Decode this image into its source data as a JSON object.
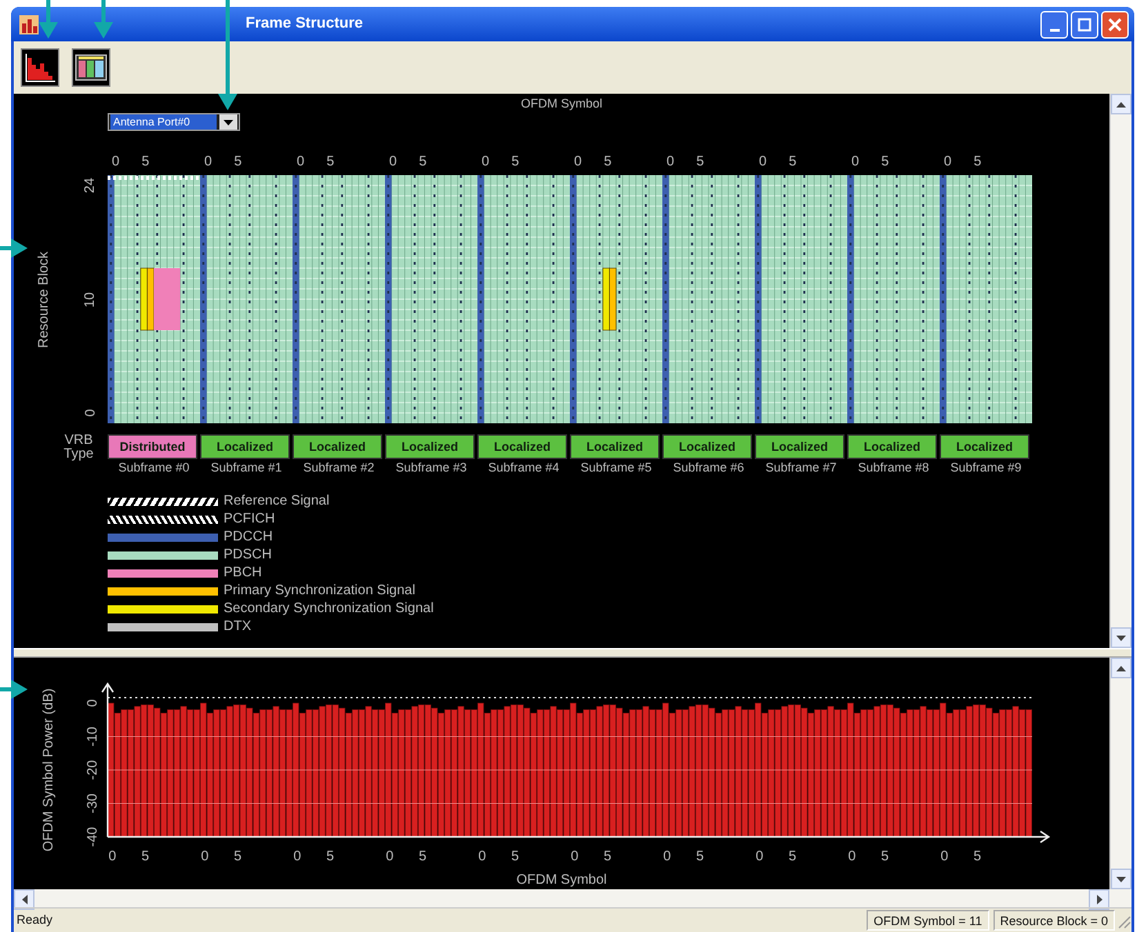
{
  "window": {
    "title": "Frame Structure"
  },
  "frame_view": {
    "title": "OFDM Symbol",
    "antenna_select": {
      "value": "Antenna Port#0"
    },
    "y_axis": {
      "label": "Resource Block",
      "ticks": [
        "24",
        "10",
        "0"
      ]
    },
    "vrb_row_label": "VRB Type",
    "subframes": [
      {
        "ticks": [
          "0",
          "5"
        ],
        "vrb_type": "Distributed",
        "color": "#e878b8",
        "label": "Subframe #0"
      },
      {
        "ticks": [
          "0",
          "5"
        ],
        "vrb_type": "Localized",
        "color": "#5cc040",
        "label": "Subframe #1"
      },
      {
        "ticks": [
          "0",
          "5"
        ],
        "vrb_type": "Localized",
        "color": "#5cc040",
        "label": "Subframe #2"
      },
      {
        "ticks": [
          "0",
          "5"
        ],
        "vrb_type": "Localized",
        "color": "#5cc040",
        "label": "Subframe #3"
      },
      {
        "ticks": [
          "0",
          "5"
        ],
        "vrb_type": "Localized",
        "color": "#5cc040",
        "label": "Subframe #4"
      },
      {
        "ticks": [
          "0",
          "5"
        ],
        "vrb_type": "Localized",
        "color": "#5cc040",
        "label": "Subframe #5"
      },
      {
        "ticks": [
          "0",
          "5"
        ],
        "vrb_type": "Localized",
        "color": "#5cc040",
        "label": "Subframe #6"
      },
      {
        "ticks": [
          "0",
          "5"
        ],
        "vrb_type": "Localized",
        "color": "#5cc040",
        "label": "Subframe #7"
      },
      {
        "ticks": [
          "0",
          "5"
        ],
        "vrb_type": "Localized",
        "color": "#5cc040",
        "label": "Subframe #8"
      },
      {
        "ticks": [
          "0",
          "5"
        ],
        "vrb_type": "Localized",
        "color": "#5cc040",
        "label": "Subframe #9"
      }
    ],
    "legend": [
      {
        "label": "Reference Signal",
        "kind": "stripe",
        "color": "#ffffff"
      },
      {
        "label": "PCFICH",
        "kind": "checker",
        "color": "#ffffff"
      },
      {
        "label": "PDCCH",
        "kind": "solid",
        "color": "#3d5fb0"
      },
      {
        "label": "PDSCH",
        "kind": "solid",
        "color": "#a8dcc0"
      },
      {
        "label": "PBCH",
        "kind": "solid",
        "color": "#f080b8"
      },
      {
        "label": "Primary Synchronization Signal",
        "kind": "solid",
        "color": "#ffc000"
      },
      {
        "label": "Secondary Synchronization Signal",
        "kind": "solid",
        "color": "#f0e800"
      },
      {
        "label": "DTX",
        "kind": "solid",
        "color": "#c0c0c0"
      }
    ]
  },
  "power_view": {
    "subframe_ticks": [
      [
        "0",
        "5"
      ],
      [
        "0",
        "5"
      ],
      [
        "0",
        "5"
      ],
      [
        "0",
        "5"
      ],
      [
        "0",
        "5"
      ],
      [
        "0",
        "5"
      ],
      [
        "0",
        "5"
      ],
      [
        "0",
        "5"
      ],
      [
        "0",
        "5"
      ],
      [
        "0",
        "5"
      ]
    ],
    "xlabel": "OFDM Symbol",
    "ylabel": "OFDM Symbol Power (dB)",
    "y_ticks": [
      "0",
      "-10",
      "-20",
      "-30",
      "-40"
    ]
  },
  "status_bar": {
    "message": "Ready",
    "fields": [
      "OFDM Symbol = 11",
      "Resource Block = 0"
    ]
  }
}
